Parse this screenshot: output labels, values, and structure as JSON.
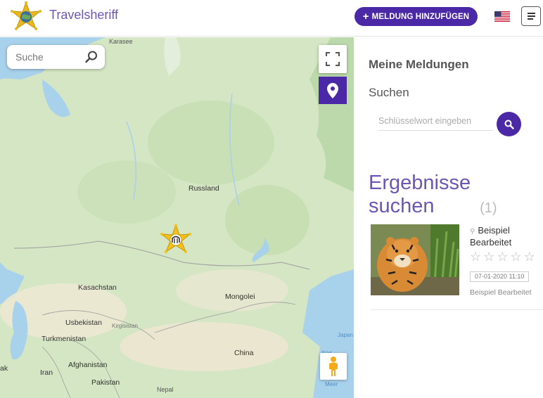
{
  "header": {
    "brand": "Travelsheriff",
    "add_button_label": "MELDUNG HINZUFÜGEN",
    "flag": "us-flag-icon",
    "menu": "hamburger-icon"
  },
  "map": {
    "search_placeholder": "Suche",
    "labels": {
      "karasee": "Karasee",
      "russland": "Russland",
      "kasachstan": "Kasachstan",
      "mongolei": "Mongolei",
      "usbekistan": "Usbekistan",
      "kirgisistan": "Kirgisistan",
      "turkmenistan": "Turkmenistan",
      "afghanistan": "Afghanistan",
      "iran": "Iran",
      "pakistan": "Pakistan",
      "china": "China",
      "nepal": "Nepal",
      "japan": "Japan",
      "sued": "Süd",
      "meer": "Meer",
      "ost": "Ost",
      "ak": "ak"
    },
    "water_color": "#a8d1ec",
    "land_color": "#d4e6c3",
    "accent": "#4b28a6"
  },
  "sidebar": {
    "title": "Meine Meldungen",
    "search_label": "Suchen",
    "search_placeholder": "Schlüsselwort eingeben",
    "results_heading": "Ergebnisse suchen",
    "results_count": "(1)",
    "results": [
      {
        "title": "Beispiel Bearbeitet",
        "rating": 0,
        "rating_max": 5,
        "date": "07-01-2020 11:10",
        "author": "Beispiel Bearbeitet"
      }
    ]
  }
}
